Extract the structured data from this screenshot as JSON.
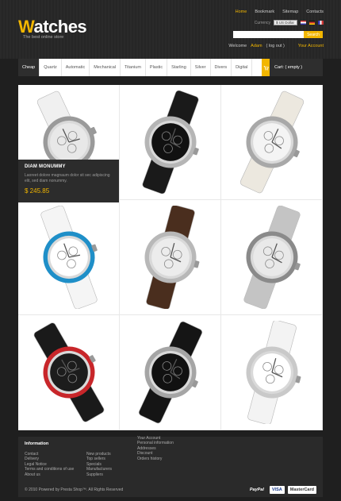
{
  "header": {
    "logo_first": "W",
    "logo_rest": "atches",
    "tagline": "The best online store",
    "top_links": [
      "Home",
      "Bookmark",
      "Sitemap",
      "Contacts"
    ],
    "currency_label": "Currency",
    "currency_value": "$ US Dollar",
    "search_placeholder": "",
    "search_button": "Search",
    "welcome": "Welcome",
    "user": "Adam",
    "logout": "( log out )",
    "your_account": "Your Account"
  },
  "nav": {
    "items": [
      "Cheap",
      "Quartz",
      "Automatic",
      "Mechanical",
      "Titanium",
      "Plastic",
      "Starling",
      "Silver",
      "Divers",
      "Digital"
    ],
    "cart": "Cart: ( empty )"
  },
  "promo": {
    "name": "DIAM MONUMMY",
    "desc": "Laoreet dolore magnaum dolor sit sec adipiscing elit, sed diam nonummy.",
    "price": "$ 245.85"
  },
  "products": [
    {
      "icon": "white-digital-watch",
      "strap": "#f0f0f0",
      "dial": "#e8e8e8",
      "bezel": "#9a9a9a"
    },
    {
      "icon": "black-chronograph-watch",
      "strap": "#1a1a1a",
      "dial": "#111111",
      "bezel": "#b5b5b5"
    },
    {
      "icon": "white-chronograph-watch",
      "strap": "#ece8df",
      "dial": "#f4f4f4",
      "bezel": "#a8a8a8"
    },
    {
      "icon": "blue-sport-watch",
      "strap": "#f5f5f5",
      "dial": "#ffffff",
      "bezel": "#1f8fc8"
    },
    {
      "icon": "brown-leather-watch",
      "strap": "#4a2e1e",
      "dial": "#ececec",
      "bezel": "#b8b8b8"
    },
    {
      "icon": "steel-chronograph-watch",
      "strap": "#c4c4c4",
      "dial": "#e9e9e9",
      "bezel": "#8a8a8a"
    },
    {
      "icon": "red-sport-watch",
      "strap": "#1a1a1a",
      "dial": "#1c1c1c",
      "bezel": "#c8262a"
    },
    {
      "icon": "black-steel-chronograph-watch",
      "strap": "#151515",
      "dial": "#111111",
      "bezel": "#a5a5a5"
    },
    {
      "icon": "orange-diver-watch",
      "strap": "#f3f3f3",
      "dial": "#ffffff",
      "bezel": "#c9c9c9"
    }
  ],
  "footer": {
    "title": "Information",
    "col1": [
      "Contact",
      "Delivery",
      "Legal Notice",
      "Terms and conditions of use",
      "About us"
    ],
    "col2": [
      "New products",
      "Top sellers",
      "Specials",
      "Manufacturers",
      "Suppliers"
    ],
    "col3": [
      "Your Account",
      "Personal information",
      "Addresses",
      "Discount",
      "Orders history"
    ],
    "copyright": "© 2010 Powered by Presta Shop™. All Rights Reserved",
    "payments": [
      "PayPal",
      "VISA",
      "MasterCard"
    ]
  },
  "colors": {
    "accent": "#f2b600",
    "dark": "#2e2e2e"
  }
}
